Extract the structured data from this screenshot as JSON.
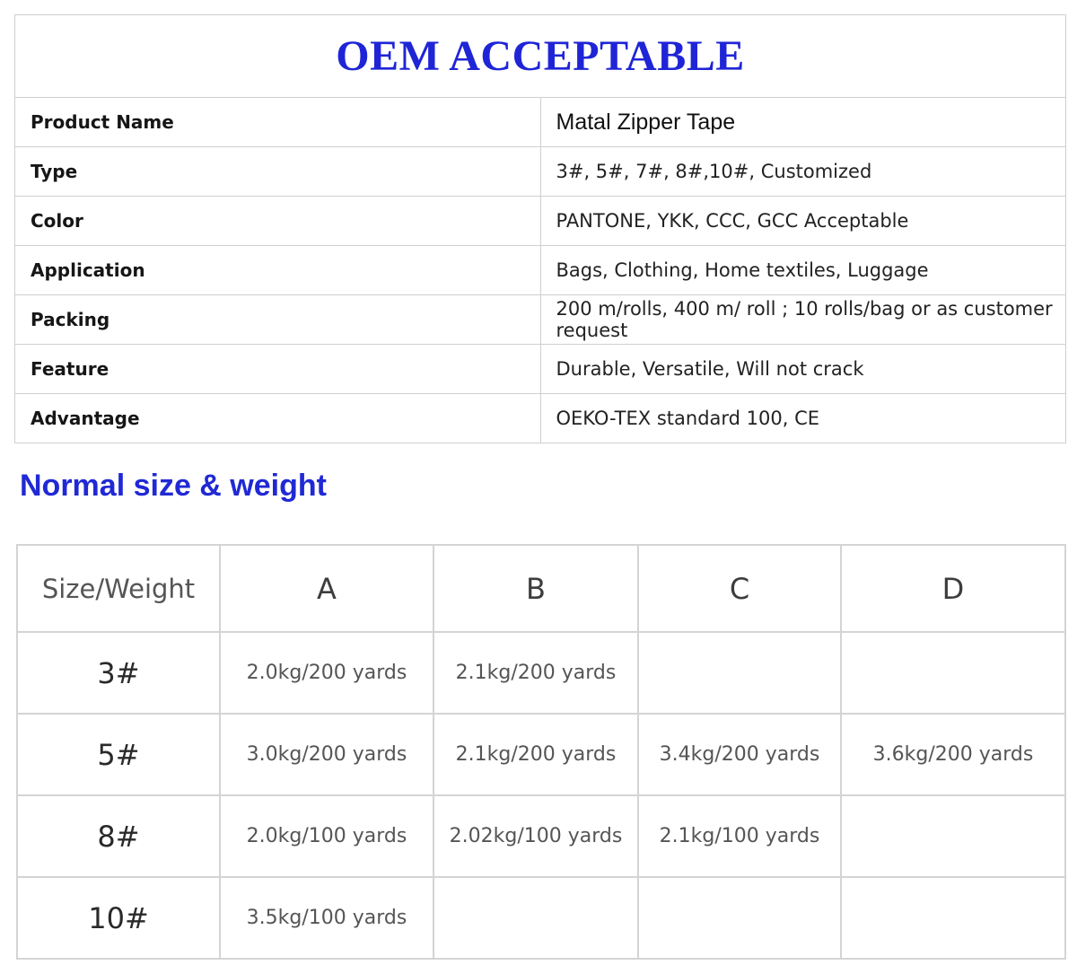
{
  "banner": {
    "title": "OEM ACCEPTABLE"
  },
  "specs": [
    {
      "label": "Product Name",
      "value": "Matal Zipper Tape"
    },
    {
      "label": "Type",
      "value": "3#, 5#, 7#, 8#,10#, Customized"
    },
    {
      "label": "Color",
      "value": "PANTONE, YKK, CCC, GCC Acceptable"
    },
    {
      "label": "Application",
      "value": "Bags, Clothing, Home textiles, Luggage"
    },
    {
      "label": "Packing",
      "value": "200 m/rolls, 400 m/ roll ; 10 rolls/bag or as customer request"
    },
    {
      "label": "Feature",
      "value": "Durable, Versatile, Will not crack"
    },
    {
      "label": "Advantage",
      "value": "OEKO-TEX standard 100, CE"
    }
  ],
  "size_section": {
    "title": "Normal size & weight",
    "corner_header": "Size/Weight",
    "columns": [
      "A",
      "B",
      "C",
      "D"
    ],
    "rows": [
      {
        "size": "3#",
        "cells": [
          "2.0kg/200 yards",
          "2.1kg/200 yards",
          "",
          ""
        ]
      },
      {
        "size": "5#",
        "cells": [
          "3.0kg/200 yards",
          "2.1kg/200 yards",
          "3.4kg/200 yards",
          "3.6kg/200 yards"
        ]
      },
      {
        "size": "8#",
        "cells": [
          "2.0kg/100 yards",
          "2.02kg/100 yards",
          "2.1kg/100 yards",
          ""
        ]
      },
      {
        "size": "10#",
        "cells": [
          "3.5kg/100 yards",
          "",
          "",
          ""
        ]
      }
    ]
  },
  "colors": {
    "title_blue": "#1f25d6",
    "heading_blue": "#2029d4",
    "grid": "#cfcfcf"
  }
}
